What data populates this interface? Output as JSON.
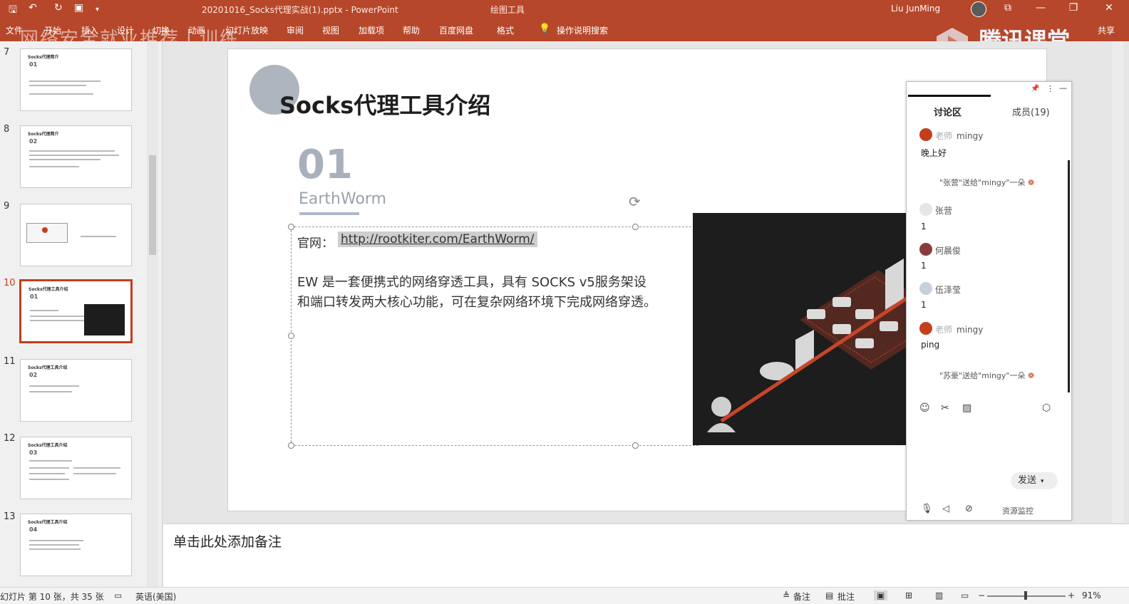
{
  "titlebar": {
    "doc_title": "20201016_Socks代理实战(1).pptx - PowerPoint",
    "tool_title": "绘图工具",
    "user": "Liu JunMing"
  },
  "ribbon": {
    "tabs": [
      "文件",
      "开始",
      "插入",
      "设计",
      "切换",
      "动画",
      "幻灯片放映",
      "审阅",
      "视图",
      "加载项",
      "帮助",
      "百度网盘",
      "格式",
      "操作说明搜索"
    ],
    "share": "共享"
  },
  "overlay": {
    "watermark": "网络安全就业推荐丨训练",
    "tencent": "腾讯课堂"
  },
  "thumbnails": [
    {
      "num": "7",
      "title": "Socks代理简介",
      "no": "01"
    },
    {
      "num": "8",
      "title": "Socks代理简介",
      "no": "02"
    },
    {
      "num": "9",
      "title": "",
      "no": ""
    },
    {
      "num": "10",
      "title": "Socks代理工具介绍",
      "no": "01"
    },
    {
      "num": "11",
      "title": "Socks代理工具介绍",
      "no": "02"
    },
    {
      "num": "12",
      "title": "Socks代理工具介绍",
      "no": "03"
    },
    {
      "num": "13",
      "title": "Socks代理工具介绍",
      "no": "04"
    }
  ],
  "slide": {
    "title": "Socks代理工具介绍",
    "number": "01",
    "subtitle": "EarthWorm",
    "site_label": "官网：",
    "site_url": "http://rootkiter.com/EarthWorm/",
    "body_line1": "EW 是一套便携式的网络穿透工具，具有 SOCKS v5服务架设",
    "body_line2": "和端口转发两大核心功能，可在复杂网络环境下完成网络穿透。"
  },
  "notes": {
    "placeholder": "单击此处添加备注"
  },
  "status": {
    "slide_info": "幻灯片 第 10 张，共 35 张",
    "language": "英语(美国)",
    "notes_btn": "备注",
    "comments_btn": "批注",
    "zoom": "91%"
  },
  "chat": {
    "tab_discussion": "讨论区",
    "tab_members": "成员(19)",
    "messages": [
      {
        "role": "老师",
        "name": "mingy",
        "text": "晚上好"
      },
      {
        "system": "\"张营\"送给\"mingy\"一朵"
      },
      {
        "name": "张营",
        "text": "1"
      },
      {
        "name": "何晨俊",
        "text": "1"
      },
      {
        "name": "伍泽莹",
        "text": "1"
      },
      {
        "role": "老师",
        "name": "mingy",
        "text": "ping"
      },
      {
        "system": "\"苏豪\"送给\"mingy\"一朵"
      }
    ],
    "send": "发送",
    "resource": "资源监控"
  }
}
